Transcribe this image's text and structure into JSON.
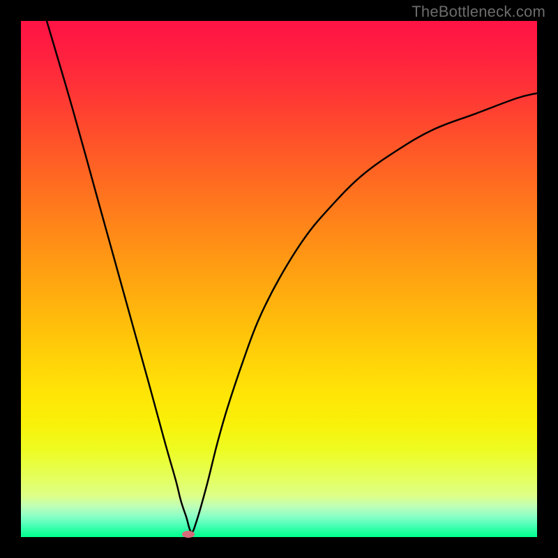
{
  "watermark": "TheBottleneck.com",
  "chart_data": {
    "type": "line",
    "title": "",
    "xlabel": "",
    "ylabel": "",
    "xlim": [
      0,
      100
    ],
    "ylim": [
      0,
      100
    ],
    "series": [
      {
        "name": "curve",
        "x": [
          5,
          10,
          15,
          20,
          25,
          28,
          30,
          31,
          32,
          33,
          34,
          36,
          38,
          40,
          43,
          46,
          50,
          55,
          60,
          66,
          73,
          80,
          88,
          96,
          100
        ],
        "y": [
          100,
          83,
          65,
          47,
          29,
          18,
          11,
          7,
          4,
          1,
          3,
          10,
          18,
          25,
          34,
          42,
          50,
          58,
          64,
          70,
          75,
          79,
          82,
          85,
          86
        ]
      }
    ],
    "marker": {
      "x": 32.4,
      "y": 0.5
    }
  },
  "colors": {
    "curve": "#000000",
    "marker": "#d86b79"
  }
}
